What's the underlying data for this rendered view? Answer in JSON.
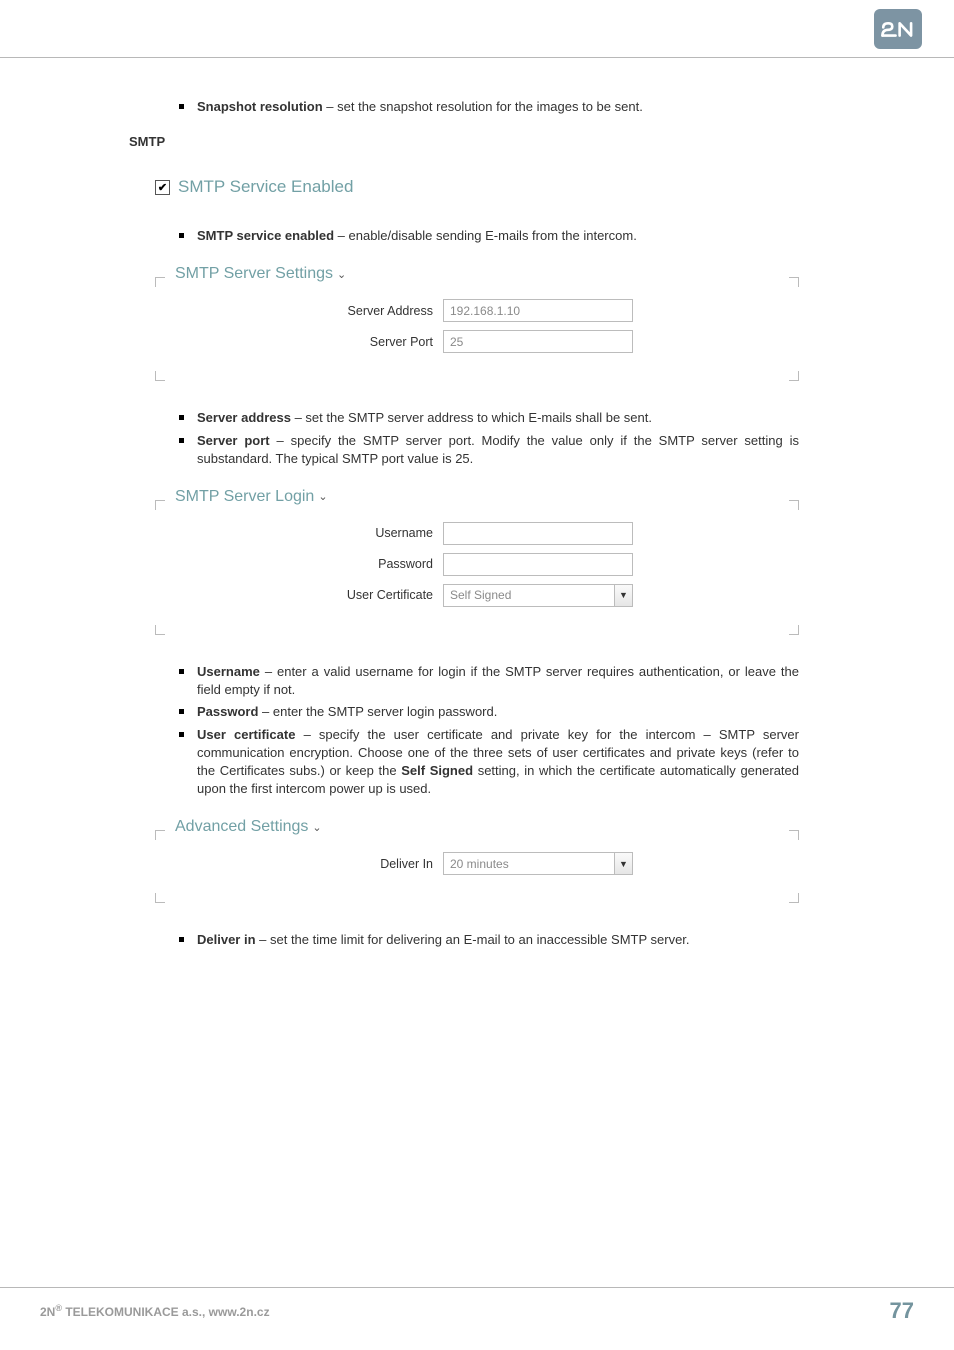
{
  "header": {
    "logo_alt": "2N"
  },
  "snapshot": {
    "term": "Snapshot resolution",
    "desc": " – set the snapshot resolution for the images to be sent."
  },
  "smtp_heading": "SMTP",
  "smtp_enabled": {
    "checkbox_checked": true,
    "label": "SMTP Service Enabled",
    "bullet_term": "SMTP service enabled",
    "bullet_desc": " – enable/disable sending E-mails from the intercom."
  },
  "server_settings": {
    "legend": "SMTP Server Settings",
    "fields": [
      {
        "label": "Server Address",
        "value": "192.168.1.10"
      },
      {
        "label": "Server Port",
        "value": "25"
      }
    ],
    "bullets": [
      {
        "term": "Server address",
        "desc": " – set the SMTP server address to which E-mails shall be sent."
      },
      {
        "term": "Server port",
        "desc": " – specify the SMTP server port. Modify the value only if the SMTP server setting is substandard. The typical SMTP port value is 25."
      }
    ]
  },
  "server_login": {
    "legend": "SMTP Server Login",
    "fields": [
      {
        "label": "Username",
        "value": ""
      },
      {
        "label": "Password",
        "value": ""
      }
    ],
    "cert_label": "User Certificate",
    "cert_value": "Self Signed",
    "bullets": [
      {
        "term": "Username",
        "desc": " – enter a valid username for login if the SMTP server requires authentication, or leave the field empty if not."
      },
      {
        "term": "Password",
        "desc": " – enter the SMTP server login password."
      },
      {
        "term": "User certificate",
        "desc_pre": " – specify the user certificate and private key for the intercom – SMTP server communication encryption. Choose one of the three sets of user certificates and private keys (refer to the Certificates subs.) or keep the ",
        "desc_bold": "Self Signed",
        "desc_post": " setting, in which the certificate automatically generated upon the first intercom power up is used."
      }
    ]
  },
  "advanced": {
    "legend": "Advanced Settings",
    "field_label": "Deliver In",
    "field_value": "20 minutes",
    "bullets": [
      {
        "term": "Deliver in",
        "desc": " – set the time limit for delivering an E-mail to an inaccessible SMTP server."
      }
    ]
  },
  "footer": {
    "company_pre": "2N",
    "company_post": " TELEKOMUNIKACE a.s., www.2n.cz",
    "page": "77"
  }
}
